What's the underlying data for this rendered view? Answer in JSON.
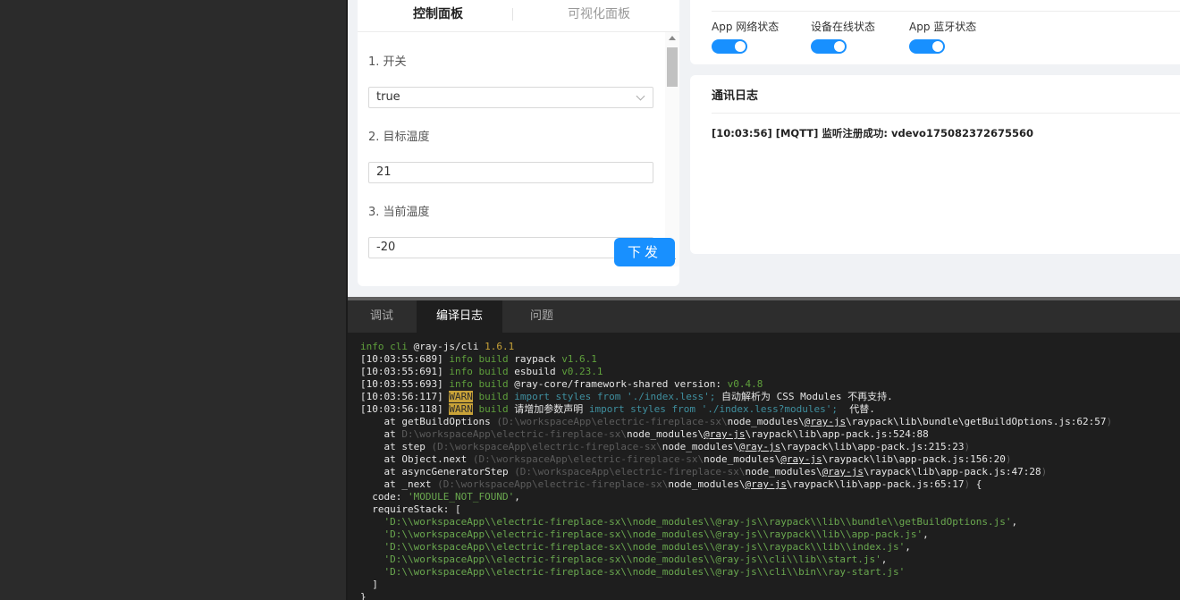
{
  "control_panel": {
    "tabs": [
      {
        "label": "控制面板",
        "active": true
      },
      {
        "label": "可视化面板",
        "active": false
      }
    ],
    "fields": [
      {
        "label": "1. 开关",
        "value": "true",
        "type": "select"
      },
      {
        "label": "2. 目标温度",
        "value": "21",
        "type": "input"
      },
      {
        "label": "3. 当前温度",
        "value": "-20",
        "type": "input"
      }
    ],
    "send_label": "下发"
  },
  "status": {
    "items": [
      {
        "label": "App 网络状态",
        "on": true
      },
      {
        "label": "设备在线状态",
        "on": true
      },
      {
        "label": "App 蓝牙状态",
        "on": true
      }
    ]
  },
  "comm_log": {
    "title": "通讯日志",
    "entries": [
      "[10:03:56] [MQTT] 监听注册成功: vdevo175082372675560"
    ]
  },
  "bottom_tabs": [
    {
      "label": "调试",
      "active": false
    },
    {
      "label": "编译日志",
      "active": true
    },
    {
      "label": "问题",
      "active": false
    }
  ],
  "console": {
    "lines": [
      [
        [
          "info cli ",
          "g"
        ],
        [
          "@ray-js/cli ",
          "w"
        ],
        [
          "1.6.1",
          "y"
        ]
      ],
      [
        [
          "[10:03:55:689] ",
          "w"
        ],
        [
          "info build ",
          "g"
        ],
        [
          "raypack ",
          "w"
        ],
        [
          "v1.6.1",
          "g"
        ]
      ],
      [
        [
          "[10:03:55:691] ",
          "w"
        ],
        [
          "info build ",
          "g"
        ],
        [
          "esbuild ",
          "w"
        ],
        [
          "v0.23.1",
          "g"
        ]
      ],
      [
        [
          "[10:03:55:693] ",
          "w"
        ],
        [
          "info build ",
          "g"
        ],
        [
          "@ray-core/framework-shared version: ",
          "w"
        ],
        [
          "v0.4.8",
          "g"
        ]
      ],
      [
        [
          "[10:03:56:117] ",
          "w"
        ],
        [
          "WARN",
          "warn"
        ],
        [
          " build ",
          "g"
        ],
        [
          "import styles from './index.less';",
          "cyan"
        ],
        [
          " 自动解析为 CSS Modules 不再支持.",
          "w"
        ]
      ],
      [
        [
          "[10:03:56:118] ",
          "w"
        ],
        [
          "WARN",
          "warn"
        ],
        [
          " build ",
          "g"
        ],
        [
          "请增加参数声明 ",
          "w"
        ],
        [
          "import styles from './index.less?modules';",
          "cyan"
        ],
        [
          "  代替.",
          "w"
        ]
      ],
      [
        [
          "    at getBuildOptions ",
          "w"
        ],
        [
          "(D:\\workspaceApp\\electric-fireplace-sx\\",
          "d"
        ],
        [
          "node_modules\\",
          "w"
        ],
        [
          "@ray-js",
          "u"
        ],
        [
          "\\raypack\\lib\\bundle\\getBuildOptions.js:62:57",
          "w"
        ],
        [
          ")",
          "d"
        ]
      ],
      [
        [
          "    at ",
          "w"
        ],
        [
          "D:\\workspaceApp\\electric-fireplace-sx\\",
          "d"
        ],
        [
          "node_modules\\",
          "w"
        ],
        [
          "@ray-js",
          "u"
        ],
        [
          "\\raypack\\lib\\app-pack.js:524:88",
          "w"
        ]
      ],
      [
        [
          "    at step ",
          "w"
        ],
        [
          "(D:\\workspaceApp\\electric-fireplace-sx\\",
          "d"
        ],
        [
          "node_modules\\",
          "w"
        ],
        [
          "@ray-js",
          "u"
        ],
        [
          "\\raypack\\lib\\app-pack.js:215:23",
          "w"
        ],
        [
          ")",
          "d"
        ]
      ],
      [
        [
          "    at Object.next ",
          "w"
        ],
        [
          "(D:\\workspaceApp\\electric-fireplace-sx\\",
          "d"
        ],
        [
          "node_modules\\",
          "w"
        ],
        [
          "@ray-js",
          "u"
        ],
        [
          "\\raypack\\lib\\app-pack.js:156:20",
          "w"
        ],
        [
          ")",
          "d"
        ]
      ],
      [
        [
          "    at asyncGeneratorStep ",
          "w"
        ],
        [
          "(D:\\workspaceApp\\electric-fireplace-sx\\",
          "d"
        ],
        [
          "node_modules\\",
          "w"
        ],
        [
          "@ray-js",
          "u"
        ],
        [
          "\\raypack\\lib\\app-pack.js:47:28",
          "w"
        ],
        [
          ")",
          "d"
        ]
      ],
      [
        [
          "    at _next ",
          "w"
        ],
        [
          "(D:\\workspaceApp\\electric-fireplace-sx\\",
          "d"
        ],
        [
          "node_modules\\",
          "w"
        ],
        [
          "@ray-js",
          "u"
        ],
        [
          "\\raypack\\lib\\app-pack.js:65:17",
          "w"
        ],
        [
          ")",
          "d"
        ],
        [
          " {",
          "w"
        ]
      ],
      [
        [
          "  code: ",
          "w"
        ],
        [
          "'MODULE_NOT_FOUND'",
          "lg"
        ],
        [
          ",",
          "w"
        ]
      ],
      [
        [
          "  requireStack: [",
          "w"
        ]
      ],
      [
        [
          "    'D:\\\\workspaceApp\\\\electric-fireplace-sx\\\\node_modules\\\\@ray-js\\\\raypack\\\\lib\\\\bundle\\\\getBuildOptions.js'",
          "lg"
        ],
        [
          ",",
          "w"
        ]
      ],
      [
        [
          "    'D:\\\\workspaceApp\\\\electric-fireplace-sx\\\\node_modules\\\\@ray-js\\\\raypack\\\\lib\\\\app-pack.js'",
          "lg"
        ],
        [
          ",",
          "w"
        ]
      ],
      [
        [
          "    'D:\\\\workspaceApp\\\\electric-fireplace-sx\\\\node_modules\\\\@ray-js\\\\raypack\\\\lib\\\\index.js'",
          "lg"
        ],
        [
          ",",
          "w"
        ]
      ],
      [
        [
          "    'D:\\\\workspaceApp\\\\electric-fireplace-sx\\\\node_modules\\\\@ray-js\\\\cli\\\\lib\\\\start.js'",
          "lg"
        ],
        [
          ",",
          "w"
        ]
      ],
      [
        [
          "    'D:\\\\workspaceApp\\\\electric-fireplace-sx\\\\node_modules\\\\@ray-js\\\\cli\\\\bin\\\\ray-start.js'",
          "lg"
        ]
      ],
      [
        [
          "  ]",
          "w"
        ]
      ],
      [
        [
          "}",
          "w"
        ]
      ]
    ]
  },
  "colors": {
    "accent": "#1890ff",
    "console_bg": "#1e1e1e",
    "info_green": "#5fa03c",
    "warn_yellow": "#c8a238"
  }
}
